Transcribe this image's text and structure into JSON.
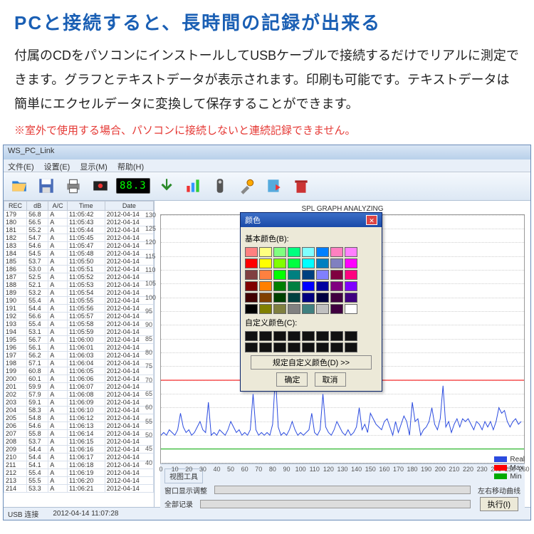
{
  "heading": "PCと接続すると、長時間の記録が出来る",
  "desc": "付属のCDをパソコンにインストールしてUSBケーブルで接続するだけでリアルに測定できます。グラフとテキストデータが表示されます。印刷も可能です。テキストデータは簡単にエクセルデータに変換して保存することができます。",
  "warn": "※室外で使用する場合、パソコンに接続しないと連続記録できません。",
  "app": {
    "title": "WS_PC_Link",
    "menu": [
      "文件(E)",
      "设置(E)",
      "显示(M)",
      "帮助(H)"
    ],
    "lcd": "88.3"
  },
  "table": {
    "headers": [
      "REC",
      "dB",
      "A/C",
      "Time",
      "Date"
    ],
    "rows": [
      [
        "179",
        "56.8",
        "A",
        "11:05:42",
        "2012-04-14"
      ],
      [
        "180",
        "56.5",
        "A",
        "11:05:43",
        "2012-04-14"
      ],
      [
        "181",
        "55.2",
        "A",
        "11:05:44",
        "2012-04-14"
      ],
      [
        "182",
        "54.7",
        "A",
        "11:05:45",
        "2012-04-14"
      ],
      [
        "183",
        "54.6",
        "A",
        "11:05:47",
        "2012-04-14"
      ],
      [
        "184",
        "54.5",
        "A",
        "11:05:48",
        "2012-04-14"
      ],
      [
        "185",
        "53.7",
        "A",
        "11:05:50",
        "2012-04-14"
      ],
      [
        "186",
        "53.0",
        "A",
        "11:05:51",
        "2012-04-14"
      ],
      [
        "187",
        "52.5",
        "A",
        "11:05:52",
        "2012-04-14"
      ],
      [
        "188",
        "52.1",
        "A",
        "11:05:53",
        "2012-04-14"
      ],
      [
        "189",
        "53.2",
        "A",
        "11:05:54",
        "2012-04-14"
      ],
      [
        "190",
        "55.4",
        "A",
        "11:05:55",
        "2012-04-14"
      ],
      [
        "191",
        "54.4",
        "A",
        "11:05:56",
        "2012-04-14"
      ],
      [
        "192",
        "56.6",
        "A",
        "11:05:57",
        "2012-04-14"
      ],
      [
        "193",
        "55.4",
        "A",
        "11:05:58",
        "2012-04-14"
      ],
      [
        "194",
        "53.1",
        "A",
        "11:05:59",
        "2012-04-14"
      ],
      [
        "195",
        "56.7",
        "A",
        "11:06:00",
        "2012-04-14"
      ],
      [
        "196",
        "56.1",
        "A",
        "11:06:01",
        "2012-04-14"
      ],
      [
        "197",
        "56.2",
        "A",
        "11:06:03",
        "2012-04-14"
      ],
      [
        "198",
        "57.1",
        "A",
        "11:06:04",
        "2012-04-14"
      ],
      [
        "199",
        "60.8",
        "A",
        "11:06:05",
        "2012-04-14"
      ],
      [
        "200",
        "60.1",
        "A",
        "11:06:06",
        "2012-04-14"
      ],
      [
        "201",
        "59.9",
        "A",
        "11:06:07",
        "2012-04-14"
      ],
      [
        "202",
        "57.9",
        "A",
        "11:06:08",
        "2012-04-14"
      ],
      [
        "203",
        "59.1",
        "A",
        "11:06:09",
        "2012-04-14"
      ],
      [
        "204",
        "58.3",
        "A",
        "11:06:10",
        "2012-04-14"
      ],
      [
        "205",
        "54.8",
        "A",
        "11:06:12",
        "2012-04-14"
      ],
      [
        "206",
        "54.6",
        "A",
        "11:06:13",
        "2012-04-14"
      ],
      [
        "207",
        "55.8",
        "A",
        "11:06:14",
        "2012-04-14"
      ],
      [
        "208",
        "53.7",
        "A",
        "11:06:15",
        "2012-04-14"
      ],
      [
        "209",
        "54.4",
        "A",
        "11:06:16",
        "2012-04-14"
      ],
      [
        "210",
        "54.4",
        "A",
        "11:06:17",
        "2012-04-14"
      ],
      [
        "211",
        "54.1",
        "A",
        "11:06:18",
        "2012-04-14"
      ],
      [
        "212",
        "55.4",
        "A",
        "11:06:19",
        "2012-04-14"
      ],
      [
        "213",
        "55.5",
        "A",
        "11:06:20",
        "2012-04-14"
      ],
      [
        "214",
        "53.3",
        "A",
        "11:06:21",
        "2012-04-14"
      ]
    ]
  },
  "chart_data": {
    "type": "line",
    "title": "SPL GRAPH ANALYZING",
    "xlabel": "",
    "ylabel": "",
    "ylim": [
      40,
      130
    ],
    "yticks": [
      40,
      45,
      50,
      55,
      60,
      65,
      70,
      75,
      80,
      85,
      90,
      95,
      100,
      105,
      110,
      115,
      120,
      125,
      130
    ],
    "xlim": [
      0,
      260
    ],
    "xticks": [
      0,
      10,
      20,
      30,
      40,
      50,
      60,
      70,
      80,
      90,
      100,
      110,
      120,
      130,
      140,
      150,
      160,
      170,
      180,
      190,
      200,
      210,
      220,
      230,
      240,
      250,
      260
    ],
    "series": [
      {
        "name": "Real",
        "color": "#2b4bdf",
        "values": [
          50,
          51,
          50,
          52,
          51,
          50,
          52,
          58,
          53,
          51,
          52,
          50,
          51,
          53,
          55,
          52,
          51,
          62,
          50,
          51,
          50,
          52,
          51,
          50,
          52,
          55,
          53,
          51,
          52,
          50,
          51,
          50,
          52,
          65,
          52,
          50,
          51,
          50,
          51,
          50,
          54,
          72,
          53,
          50,
          51,
          50,
          52,
          55,
          52,
          50,
          51,
          50,
          51,
          52,
          58,
          51,
          50,
          52,
          65,
          53,
          51,
          50,
          52,
          55,
          53,
          51,
          50,
          52,
          50,
          51,
          53,
          60,
          52,
          54,
          51,
          58,
          56,
          54,
          53,
          52,
          55,
          56,
          53,
          50,
          55,
          51,
          54,
          57,
          55,
          50,
          62,
          55,
          56,
          50,
          52,
          53,
          55,
          60,
          54,
          52,
          56,
          68,
          53,
          55,
          51,
          54,
          56,
          53,
          56,
          55,
          56,
          54,
          52,
          55,
          54,
          52,
          55,
          53,
          55,
          52,
          55,
          60,
          58,
          59,
          55,
          53,
          55,
          56,
          54,
          55
        ]
      },
      {
        "name": "Max",
        "color": "#ff0000",
        "constant": 70
      },
      {
        "name": "Min",
        "color": "#00aa00",
        "constant": 45
      }
    ]
  },
  "colordialog": {
    "title": "颜色",
    "basic_label": "基本颜色(B):",
    "custom_label": "自定义颜色(C):",
    "define_btn": "规定自定义颜色(D) >>",
    "ok": "确定",
    "cancel": "取消",
    "basic_colors": [
      "#ff8080",
      "#ffff80",
      "#80ff80",
      "#00ff80",
      "#80ffff",
      "#0080ff",
      "#ff80c0",
      "#ff80ff",
      "#ff0000",
      "#ffff00",
      "#80ff00",
      "#00ff40",
      "#00ffff",
      "#0080c0",
      "#8080c0",
      "#ff00ff",
      "#804040",
      "#ff8040",
      "#00ff00",
      "#008080",
      "#004080",
      "#8080ff",
      "#800040",
      "#ff0080",
      "#800000",
      "#ff8000",
      "#008000",
      "#008040",
      "#0000ff",
      "#0000a0",
      "#800080",
      "#8000ff",
      "#400000",
      "#804000",
      "#004000",
      "#004040",
      "#000080",
      "#000040",
      "#400040",
      "#400080",
      "#000000",
      "#808000",
      "#808040",
      "#808080",
      "#408080",
      "#c0c0c0",
      "#400040",
      "#ffffff"
    ]
  },
  "bottom": {
    "section1": "视图工具",
    "label1": "窗口显示调整",
    "label2": "左右移动曲线",
    "label3": "全部记录",
    "btn": "执行(I)"
  },
  "legend": {
    "real": "Real",
    "max": "Max",
    "min": "Min"
  },
  "status": {
    "left": "USB 连接",
    "right": "2012-04-14  11:07:28"
  }
}
